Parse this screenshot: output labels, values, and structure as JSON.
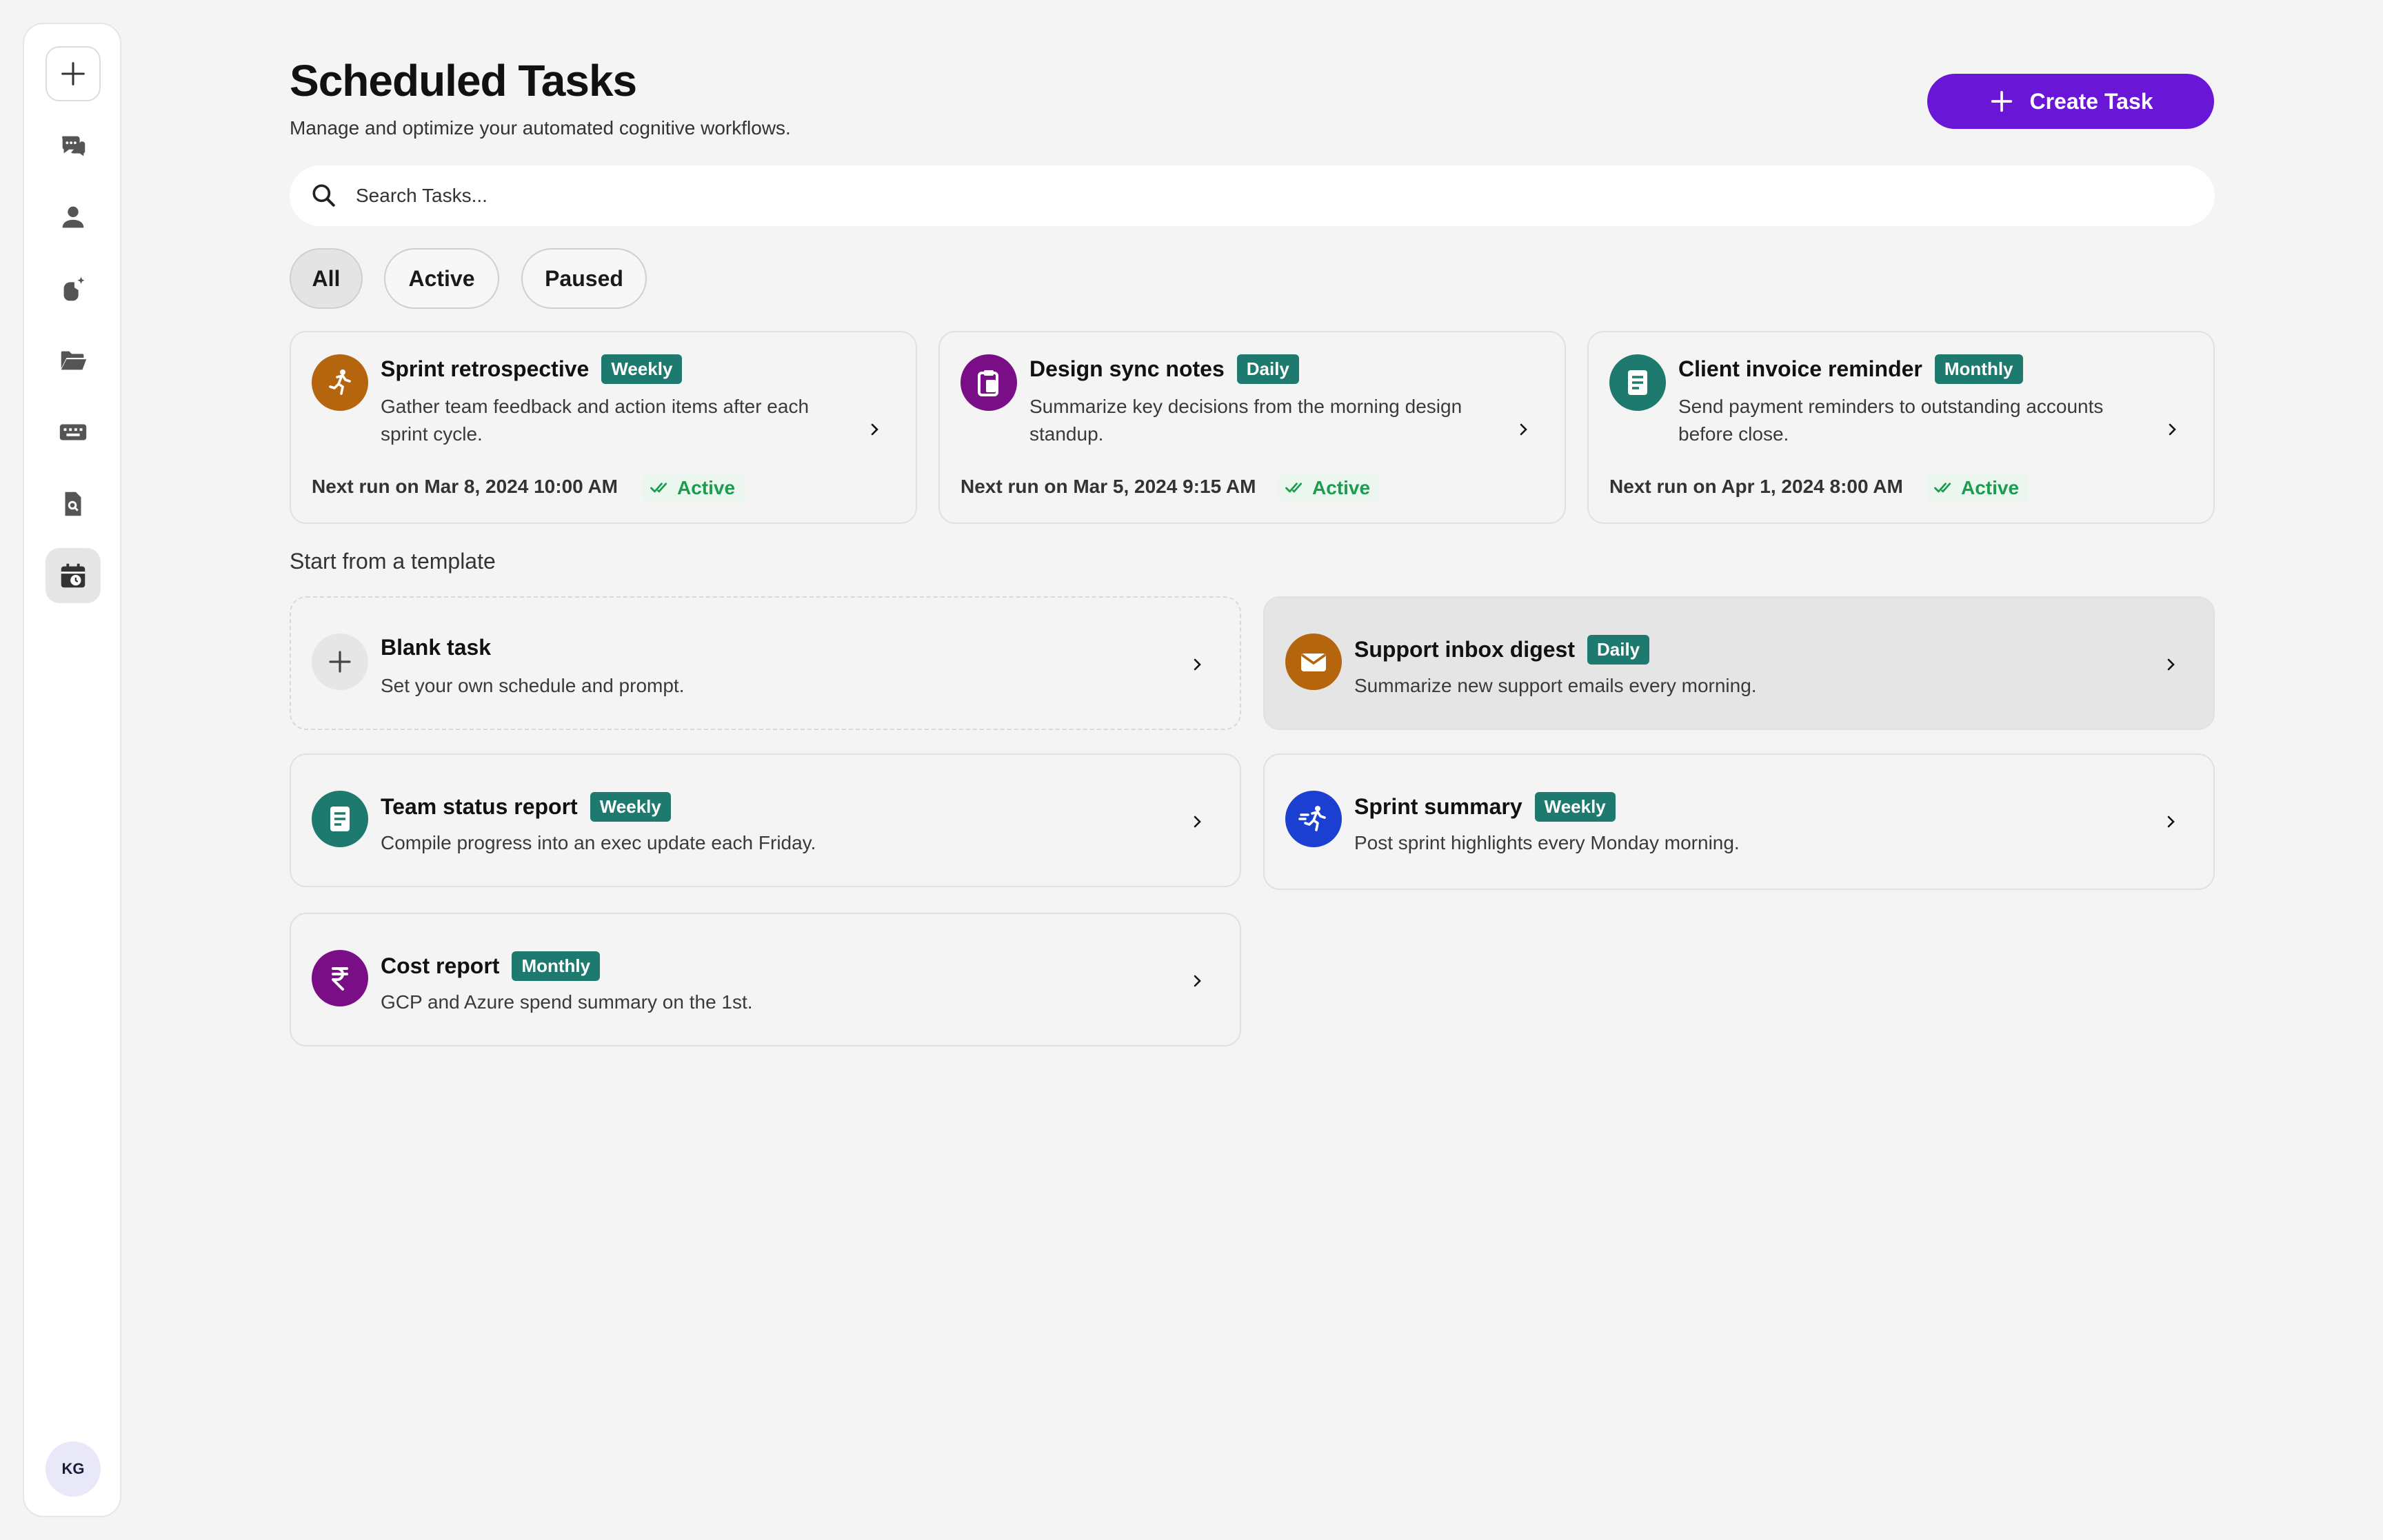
{
  "sidebar": {
    "items": [
      {
        "name": "new-chat",
        "icon": "plus-icon"
      },
      {
        "name": "chats",
        "icon": "chat-bubbles-icon"
      },
      {
        "name": "people",
        "icon": "person-icon"
      },
      {
        "name": "agents",
        "icon": "sparkle-hand-icon"
      },
      {
        "name": "files",
        "icon": "folder-open-icon"
      },
      {
        "name": "keyboard",
        "icon": "keyboard-icon"
      },
      {
        "name": "documents",
        "icon": "file-search-icon"
      },
      {
        "name": "scheduled",
        "icon": "calendar-clock-icon",
        "active": true
      }
    ],
    "avatar_initials": "KG"
  },
  "header": {
    "title": "Scheduled Tasks",
    "subtitle": "Manage and optimize your automated cognitive workflows.",
    "create_label": "Create Task"
  },
  "search": {
    "placeholder": "Search Tasks..."
  },
  "filters": {
    "all": "All",
    "active": "Active",
    "paused": "Paused",
    "selected": "All"
  },
  "tasks": [
    {
      "title": "Sprint retrospective",
      "badge": "Weekly",
      "description": "Gather team feedback and action items after each sprint cycle.",
      "next_run": "Next run on Mar 8, 2024 10:00 AM",
      "status": "Active",
      "icon": "running-person-icon",
      "icon_color": "#b5650d"
    },
    {
      "title": "Design sync notes",
      "badge": "Daily",
      "description": "Summarize key decisions from the morning design standup.",
      "next_run": "Next run on Mar 5, 2024 9:15 AM",
      "status": "Active",
      "icon": "clipboard-icon",
      "icon_color": "#7a0e87"
    },
    {
      "title": "Client invoice reminder",
      "badge": "Monthly",
      "description": "Send payment reminders to outstanding accounts before close.",
      "next_run": "Next run on Apr 1, 2024 8:00 AM",
      "status": "Active",
      "icon": "report-icon",
      "icon_color": "#1e7a6e"
    }
  ],
  "templates": {
    "section_label": "Start from a template",
    "items": [
      {
        "title": "Blank task",
        "badge": "",
        "description": "Set your own schedule and prompt.",
        "icon": "plus-icon",
        "icon_color": "#e6e6e6"
      },
      {
        "title": "Support inbox digest",
        "badge": "Daily",
        "description": "Summarize new support emails every morning.",
        "icon": "mail-icon",
        "icon_color": "#b5650d"
      },
      {
        "title": "Team status report",
        "badge": "Weekly",
        "description": "Compile progress into an exec update each Friday.",
        "icon": "report-icon",
        "icon_color": "#1e7a6e"
      },
      {
        "title": "Sprint summary",
        "badge": "Weekly",
        "description": "Post sprint highlights every Monday morning.",
        "icon": "sprint-runner-icon",
        "icon_color": "#1a3fd1"
      },
      {
        "title": "Cost report",
        "badge": "Monthly",
        "description": "GCP and Azure spend summary on the 1st.",
        "icon": "rupee-icon",
        "icon_color": "#7a0e87"
      }
    ]
  },
  "colors": {
    "accent": "#6a16d6",
    "badge": "#1e7a6e",
    "status_green": "#1b9c4e",
    "background": "#f4f4f4"
  }
}
